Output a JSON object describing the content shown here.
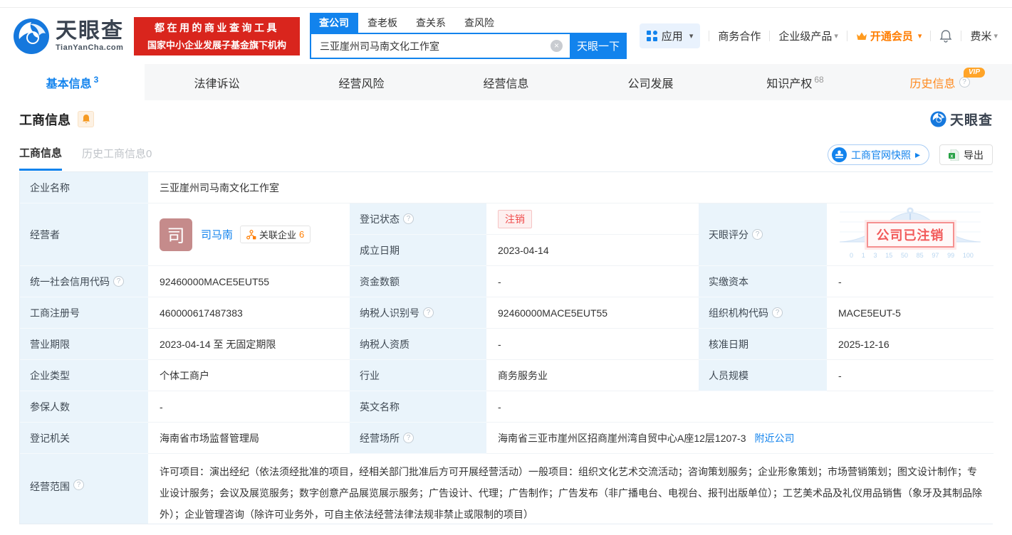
{
  "icons": {
    "help": "?",
    "clear": "×",
    "caret": "▾",
    "arrow_right": "▸",
    "excel_x": "x"
  },
  "header": {
    "logo": {
      "title": "天眼查",
      "subtitle": "TianYanCha.com"
    },
    "banner": {
      "line1": "都在用的商业查询工具",
      "line2": "国家中小企业发展子基金旗下机构"
    },
    "search": {
      "tabs": [
        {
          "label": "查公司"
        },
        {
          "label": "查老板"
        },
        {
          "label": "查关系"
        },
        {
          "label": "查风险"
        }
      ],
      "value": "三亚崖州司马南文化工作室",
      "button": "天眼一下"
    },
    "nav": {
      "apps": "应用",
      "cooperation": "商务合作",
      "enterprise": "企业级产品",
      "vip": "开通会员",
      "user": "费米"
    }
  },
  "tabbar": {
    "tabs": [
      {
        "label": "基本信息",
        "count": "3"
      },
      {
        "label": "法律诉讼"
      },
      {
        "label": "经营风险"
      },
      {
        "label": "经营信息"
      },
      {
        "label": "公司发展"
      },
      {
        "label": "知识产权",
        "count": "68"
      },
      {
        "label": "历史信息",
        "vip": "VIP"
      }
    ]
  },
  "section": {
    "title": "工商信息",
    "brand": "天眼查",
    "subtabs": {
      "current": "工商信息",
      "history": "历史工商信息",
      "history_count": "0"
    },
    "snapshot_button": "工商官网快照",
    "export_button": "导出"
  },
  "table": {
    "company_name": {
      "label": "企业名称",
      "value": "三亚崖州司马南文化工作室"
    },
    "operator": {
      "label": "经营者",
      "avatar": "司",
      "name": "司马南",
      "related_label": "关联企业",
      "related_count": "6"
    },
    "reg_status": {
      "label": "登记状态",
      "value": "注销"
    },
    "establish_date": {
      "label": "成立日期",
      "value": "2023-04-14"
    },
    "tyc_score": {
      "label": "天眼评分",
      "stamp": "公司已注销",
      "axis": [
        "0",
        "1",
        "3",
        "15",
        "50",
        "85",
        "97",
        "99",
        "100"
      ]
    },
    "credit_code": {
      "label": "统一社会信用代码",
      "value": "92460000MACE5EUT55"
    },
    "capital": {
      "label": "资金数额",
      "value": "-"
    },
    "paid_capital": {
      "label": "实缴资本",
      "value": "-"
    },
    "reg_number": {
      "label": "工商注册号",
      "value": "460000617487383"
    },
    "taxpayer_id": {
      "label": "纳税人识别号",
      "value": "92460000MACE5EUT55"
    },
    "org_code": {
      "label": "组织机构代码",
      "value": "MACE5EUT-5"
    },
    "business_term": {
      "label": "营业期限",
      "value": "2023-04-14 至 无固定期限"
    },
    "taxpayer_quali": {
      "label": "纳税人资质",
      "value": "-"
    },
    "approval_date": {
      "label": "核准日期",
      "value": "2025-12-16"
    },
    "company_type": {
      "label": "企业类型",
      "value": "个体工商户"
    },
    "industry": {
      "label": "行业",
      "value": "商务服务业"
    },
    "staff_size": {
      "label": "人员规模",
      "value": "-"
    },
    "insured_count": {
      "label": "参保人数",
      "value": "-"
    },
    "english_name": {
      "label": "英文名称",
      "value": "-"
    },
    "reg_authority": {
      "label": "登记机关",
      "value": "海南省市场监督管理局"
    },
    "business_site": {
      "label": "经营场所",
      "value": "海南省三亚市崖州区招商崖州湾自贸中心A座12层1207-3",
      "link": "附近公司"
    },
    "business_scope": {
      "label": "经营范围",
      "value": "许可项目：演出经纪（依法须经批准的项目，经相关部门批准后方可开展经营活动）一般项目：组织文化艺术交流活动；咨询策划服务；企业形象策划；市场营销策划；图文设计制作；专业设计服务；会议及展览服务；数字创意产品展览展示服务；广告设计、代理；广告制作；广告发布（非广播电台、电视台、报刊出版单位）；工艺美术品及礼仪用品销售（象牙及其制品除外）；企业管理咨询（除许可业务外，可自主依法经营法律法规非禁止或限制的项目）"
    }
  }
}
